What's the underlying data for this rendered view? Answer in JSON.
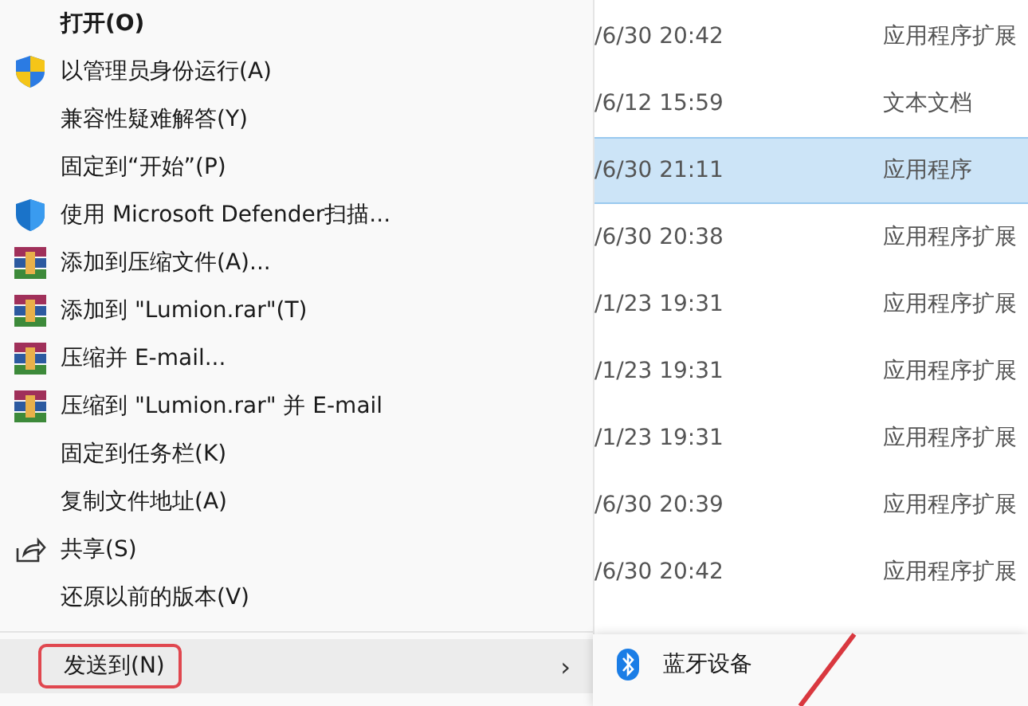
{
  "context_menu": {
    "items": [
      {
        "label": "打开(O)",
        "kind": "plain",
        "bold": true
      },
      {
        "label": "以管理员身份运行(A)",
        "kind": "uac-shield",
        "bold": false
      },
      {
        "label": "兼容性疑难解答(Y)",
        "kind": "plain",
        "bold": false
      },
      {
        "label": "固定到“开始”(P)",
        "kind": "plain",
        "bold": false
      },
      {
        "label": "使用 Microsoft Defender扫描...",
        "kind": "defender",
        "bold": false
      },
      {
        "label": "添加到压缩文件(A)...",
        "kind": "archive",
        "bold": false
      },
      {
        "label": "添加到 \"Lumion.rar\"(T)",
        "kind": "archive",
        "bold": false
      },
      {
        "label": "压缩并 E-mail...",
        "kind": "archive",
        "bold": false
      },
      {
        "label": "压缩到 \"Lumion.rar\" 并 E-mail",
        "kind": "archive",
        "bold": false
      },
      {
        "label": "固定到任务栏(K)",
        "kind": "plain",
        "bold": false
      },
      {
        "label": "复制文件地址(A)",
        "kind": "plain",
        "bold": false
      },
      {
        "label": "共享(S)",
        "kind": "share",
        "bold": false
      },
      {
        "label": "还原以前的版本(V)",
        "kind": "plain",
        "bold": false
      }
    ],
    "send_to": {
      "label": "发送到(N)",
      "arrow": "›",
      "highlighted": true,
      "annotated": true
    }
  },
  "file_list": {
    "rows": [
      {
        "date": "/6/30 20:42",
        "type": "应用程序扩展",
        "selected": false
      },
      {
        "date": "/6/12 15:59",
        "type": "文本文档",
        "selected": false
      },
      {
        "date": "/6/30 21:11",
        "type": "应用程序",
        "selected": true
      },
      {
        "date": "/6/30 20:38",
        "type": "应用程序扩展",
        "selected": false
      },
      {
        "date": "/1/23 19:31",
        "type": "应用程序扩展",
        "selected": false
      },
      {
        "date": "/1/23 19:31",
        "type": "应用程序扩展",
        "selected": false
      },
      {
        "date": "/1/23 19:31",
        "type": "应用程序扩展",
        "selected": false
      },
      {
        "date": "/6/30 20:39",
        "type": "应用程序扩展",
        "selected": false
      },
      {
        "date": "/6/30 20:42",
        "type": "应用程序扩展",
        "selected": false
      }
    ]
  },
  "submenu": {
    "items": [
      {
        "label": "蓝牙设备",
        "kind": "bluetooth"
      }
    ]
  }
}
